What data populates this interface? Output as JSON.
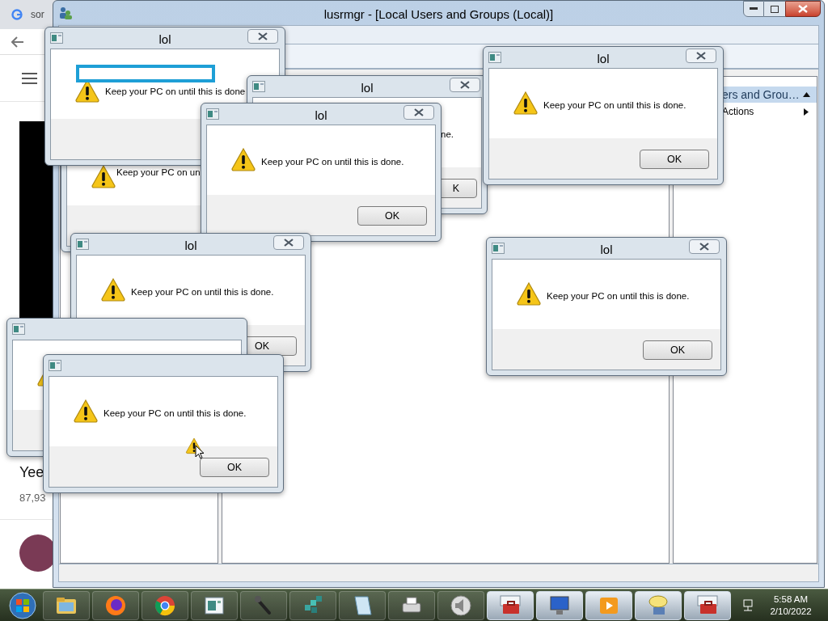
{
  "browser": {
    "tab_title": "sor",
    "video_title": "Yee",
    "views": "87,93"
  },
  "window": {
    "title": "lusrmgr - [Local Users and Groups (Local)]",
    "actions_pane": {
      "header": "ers and Grou…",
      "items": [
        {
          "label": "Actions"
        }
      ]
    }
  },
  "dialogs": [
    {
      "kind": "dialog",
      "title": "lol",
      "message": "Keep your PC on until this is done"
    },
    {
      "kind": "dialog",
      "message": "Keep your PC on un"
    },
    {
      "kind": "dialog",
      "title": "lol",
      "message": "ne.",
      "ok": "K"
    },
    {
      "kind": "dialog",
      "title": "lol",
      "message": "Keep your PC on until this is done.",
      "ok": "OK"
    },
    {
      "kind": "dialog",
      "title": "lol",
      "message": "Keep your PC on until this is done.",
      "ok": "OK"
    },
    {
      "kind": "dialog",
      "title": "lol",
      "message": "Keep your PC on until this is done.",
      "ok": "OK"
    },
    {
      "kind": "dialog",
      "title": "lol",
      "message": "Keep your PC on until this is done.",
      "ok": "OK"
    },
    {
      "kind": "dialog"
    },
    {
      "kind": "dialog",
      "message": "Keep your PC on until this is done.",
      "ok": "OK"
    }
  ],
  "taskbar": {
    "buttons": [
      {
        "highlighted": false
      },
      {
        "highlighted": false
      },
      {
        "highlighted": false
      },
      {
        "highlighted": false
      },
      {
        "highlighted": false
      },
      {
        "highlighted": false
      },
      {
        "highlighted": false
      },
      {
        "highlighted": false
      },
      {
        "highlighted": false
      },
      {
        "highlighted": true
      },
      {
        "highlighted": true
      },
      {
        "highlighted": true
      },
      {
        "highlighted": true
      },
      {
        "highlighted": true
      }
    ],
    "clock": {
      "time": "5:58 AM",
      "date": "2/10/2022"
    }
  }
}
